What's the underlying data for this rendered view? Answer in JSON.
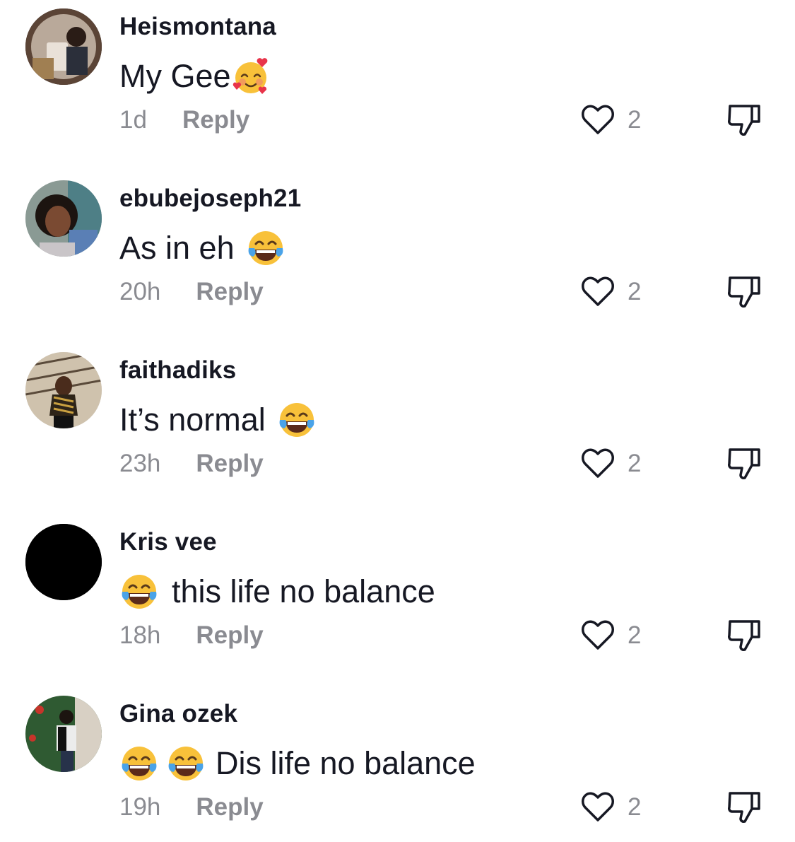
{
  "comments": [
    {
      "username": "Heismontana",
      "text_before": "",
      "text_after": "My Gee",
      "emojis_leading": [],
      "emojis_trailing": [
        "smiling-face-with-hearts"
      ],
      "time": "1d",
      "reply_label": "Reply",
      "likes": "2",
      "avatar": "photo"
    },
    {
      "username": "ebubejoseph21",
      "text_before": "",
      "text_after": "As in eh",
      "emojis_leading": [],
      "emojis_trailing": [
        "face-with-tears-of-joy"
      ],
      "time": "20h",
      "reply_label": "Reply",
      "likes": "2",
      "avatar": "photo"
    },
    {
      "username": "faithadiks",
      "text_before": "",
      "text_after": "It’s normal",
      "emojis_leading": [],
      "emojis_trailing": [
        "face-with-tears-of-joy"
      ],
      "time": "23h",
      "reply_label": "Reply",
      "likes": "2",
      "avatar": "photo"
    },
    {
      "username": "Kris vee",
      "text_before": "",
      "text_after": "this life no balance",
      "emojis_leading": [
        "face-with-tears-of-joy"
      ],
      "emojis_trailing": [],
      "time": "18h",
      "reply_label": "Reply",
      "likes": "2",
      "avatar": "black"
    },
    {
      "username": "Gina ozek",
      "text_before": "",
      "text_after": "Dis life no balance",
      "emojis_leading": [
        "face-with-tears-of-joy",
        "face-with-tears-of-joy"
      ],
      "emojis_trailing": [],
      "time": "19h",
      "reply_label": "Reply",
      "likes": "2",
      "avatar": "photo"
    }
  ],
  "icons": {
    "like": "heart-outline-icon",
    "dislike": "thumbs-down-icon"
  },
  "colors": {
    "primary_text": "#161823",
    "secondary_text": "#8a8b91",
    "icon": "#161823"
  }
}
